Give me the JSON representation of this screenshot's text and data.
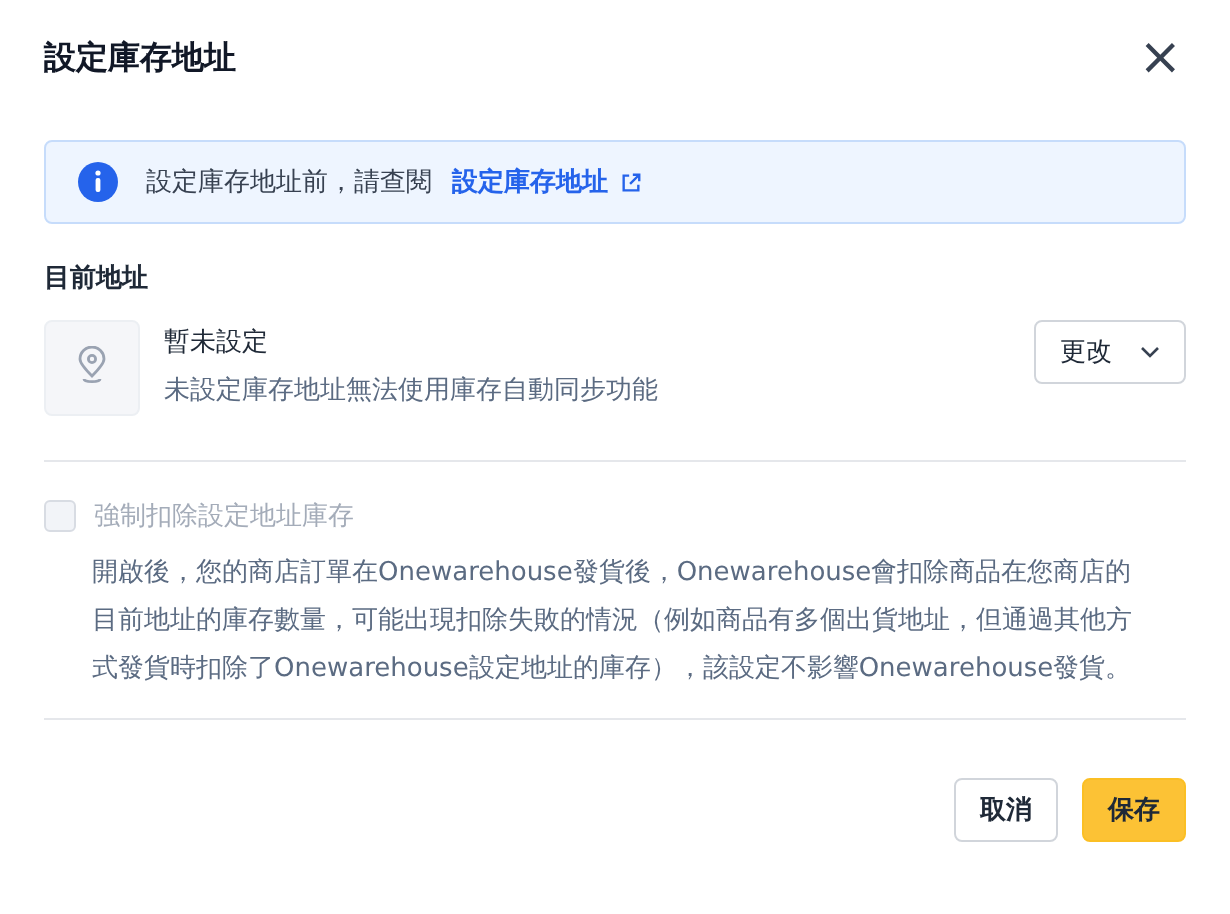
{
  "dialog": {
    "title": "設定庫存地址",
    "close": "×"
  },
  "notice": {
    "text": "設定庫存地址前，請查閱",
    "link": "設定庫存地址"
  },
  "current_address": {
    "heading": "目前地址",
    "name": "暫未設定",
    "description": "未設定庫存地址無法使用庫存自動同步功能",
    "change_button": "更改"
  },
  "force_deduct": {
    "label": "強制扣除設定地址庫存",
    "checked": false,
    "disabled": true,
    "description": "開啟後，您的商店訂單在Onewarehouse發貨後，Onewarehouse會扣除商品在您商店的目前地址的庫存數量，可能出現扣除失敗的情況（例如商品有多個出貨地址，但通過其他方式發貨時扣除了Onewarehouse設定地址的庫存），該設定不影響Onewarehouse發貨。"
  },
  "buttons": [
    {
      "label": "取消",
      "kind": "secondary"
    },
    {
      "label": "保存",
      "kind": "primary"
    }
  ]
}
